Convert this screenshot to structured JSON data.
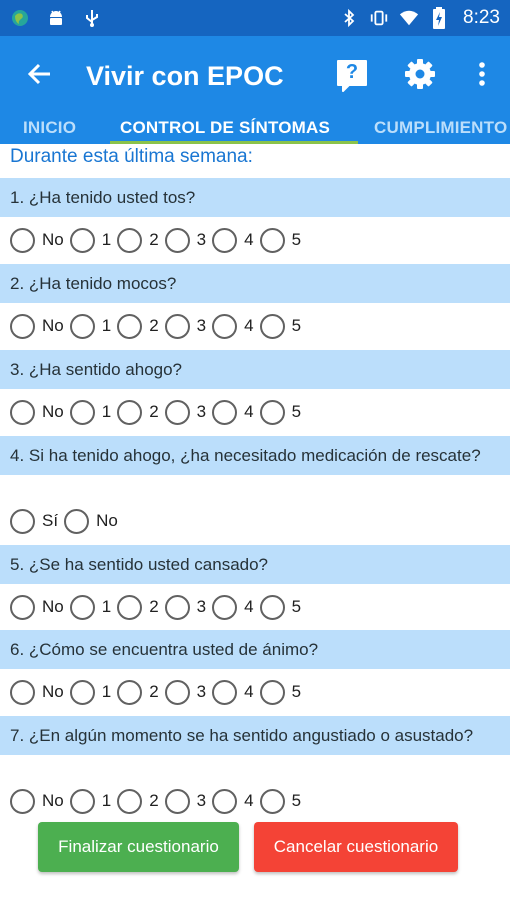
{
  "status_bar": {
    "time": "8:23",
    "left_icons": [
      "globe-app-icon",
      "android-icon",
      "usb-icon"
    ],
    "right_icons": [
      "bluetooth-icon",
      "vibrate-icon",
      "wifi-icon",
      "battery-icon"
    ]
  },
  "app_bar": {
    "title": "Vivir con EPOC",
    "help_label": "?"
  },
  "tabs": [
    "INICIO",
    "CONTROL DE SÍNTOMAS",
    "CUMPLIMIENTO"
  ],
  "active_tab": 1,
  "intro": "Durante esta última semana:",
  "questions": [
    {
      "text": "1. ¿Ha tenido usted tos?",
      "options": [
        "No",
        "1",
        "2",
        "3",
        "4",
        "5"
      ]
    },
    {
      "text": "2. ¿Ha tenido mocos?",
      "options": [
        "No",
        "1",
        "2",
        "3",
        "4",
        "5"
      ]
    },
    {
      "text": "3. ¿Ha sentido ahogo?",
      "options": [
        "No",
        "1",
        "2",
        "3",
        "4",
        "5"
      ]
    },
    {
      "text": "4. Si ha tenido ahogo, ¿ha necesitado medicación de rescate?",
      "options": [
        "Sí",
        "No"
      ]
    },
    {
      "text": "5. ¿Se ha sentido usted cansado?",
      "options": [
        "No",
        "1",
        "2",
        "3",
        "4",
        "5"
      ]
    },
    {
      "text": "6. ¿Cómo se encuentra usted de ánimo?",
      "options": [
        "No",
        "1",
        "2",
        "3",
        "4",
        "5"
      ]
    },
    {
      "text": "7. ¿En algún momento se ha sentido angustiado o asustado?",
      "options": [
        "No",
        "1",
        "2",
        "3",
        "4",
        "5"
      ]
    }
  ],
  "buttons": {
    "finish": "Finalizar cuestionario",
    "cancel": "Cancelar cuestionario"
  },
  "colors": {
    "primary": "#1E88E5",
    "status": "#1565C0",
    "question_bg": "#BBDEFB",
    "tab_indicator": "#8BC34A",
    "finish": "#4CAF50",
    "cancel": "#F44336"
  }
}
